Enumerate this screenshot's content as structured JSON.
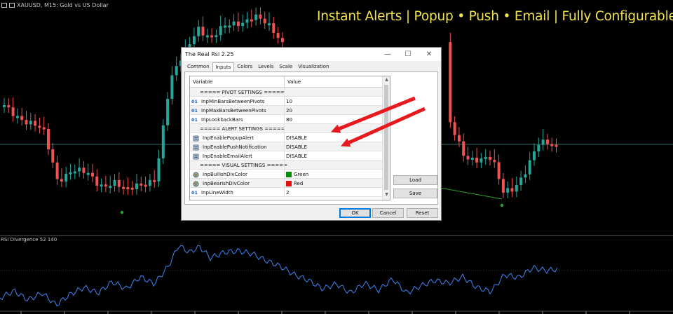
{
  "symbol_bar": {
    "text": "XAUUSD, M15: Gold vs US Dollar"
  },
  "promo": {
    "text": "Instant Alerts | Popup • Push • Email | Fully Configurable"
  },
  "indicator_label": "RSI Divergence 52 140",
  "colors": {
    "bull": "#26a69a",
    "bear": "#ef5350",
    "rsi": "#3b7be0",
    "arrow": "#e8191e",
    "alert_line": "#2aa42a"
  },
  "dialog": {
    "title": "The Real Rsi 2.25",
    "controls": {
      "minimize": "—",
      "maximize": "☐",
      "close": "✕"
    },
    "tabs": [
      "Common",
      "Inputs",
      "Colors",
      "Levels",
      "Scale",
      "Visualization"
    ],
    "active_tab": "Inputs",
    "columns": {
      "variable": "Variable",
      "value": "Value"
    },
    "rows": [
      {
        "type": "section",
        "label": "===== PIVOT SETTINGS ====="
      },
      {
        "type": "param",
        "kind": "int",
        "tag": "01",
        "name": "InpMinBarsBetweenPivots",
        "value": "10"
      },
      {
        "type": "param",
        "kind": "int",
        "tag": "01",
        "name": "InpMaxBarsBetweenPivots",
        "value": "20"
      },
      {
        "type": "param",
        "kind": "int",
        "tag": "01",
        "name": "InpLookbackBars",
        "value": "80"
      },
      {
        "type": "section",
        "label": "===== ALERT SETTINGS ====="
      },
      {
        "type": "param",
        "kind": "enum",
        "name": "InpEnablePopupAlert",
        "value": "DISABLE"
      },
      {
        "type": "param",
        "kind": "enum",
        "name": "InpEnablePushNotification",
        "value": "DISABLE"
      },
      {
        "type": "param",
        "kind": "enum",
        "name": "InpEnableEmailAlert",
        "value": "DISABLE"
      },
      {
        "type": "section",
        "label": "===== VISUAL SETTINGS ====="
      },
      {
        "type": "param",
        "kind": "color",
        "name": "InpBullishDivColor",
        "value": "Green",
        "swatch": "#0a8a0a"
      },
      {
        "type": "param",
        "kind": "color",
        "name": "InpBearishDivColor",
        "value": "Red",
        "swatch": "#e01010"
      },
      {
        "type": "param",
        "kind": "int",
        "tag": "01",
        "name": "InpLineWidth",
        "value": "2"
      }
    ],
    "load_label": "Load",
    "save_label": "Save",
    "ok_label": "OK",
    "cancel_label": "Cancel",
    "reset_label": "Reset"
  }
}
